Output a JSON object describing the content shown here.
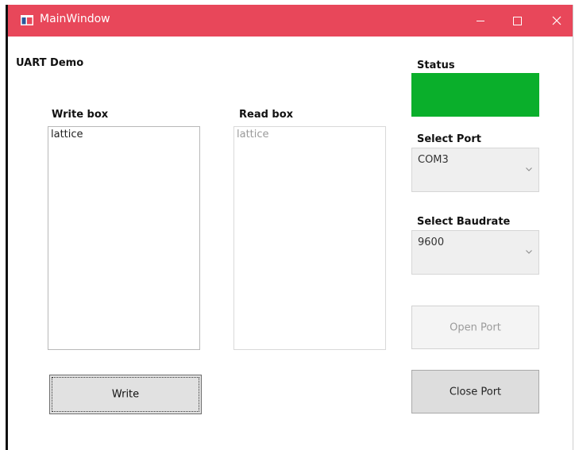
{
  "window": {
    "title": "MainWindow",
    "titlebar_color": "#e8475a",
    "controls": {
      "minimize_icon": "minimize-icon",
      "maximize_icon": "maximize-icon",
      "close_icon": "close-icon"
    }
  },
  "app": {
    "heading": "UART Demo"
  },
  "write_box": {
    "label": "Write box",
    "value": "lattice"
  },
  "read_box": {
    "label": "Read box",
    "value": "lattice"
  },
  "status": {
    "label": "Status",
    "indicator_color": "#0aaf2b"
  },
  "port": {
    "label": "Select Port",
    "selected": "COM3"
  },
  "baudrate": {
    "label": "Select Baudrate",
    "selected": "9600"
  },
  "buttons": {
    "write": "Write",
    "open_port": "Open Port",
    "close_port": "Close Port"
  }
}
